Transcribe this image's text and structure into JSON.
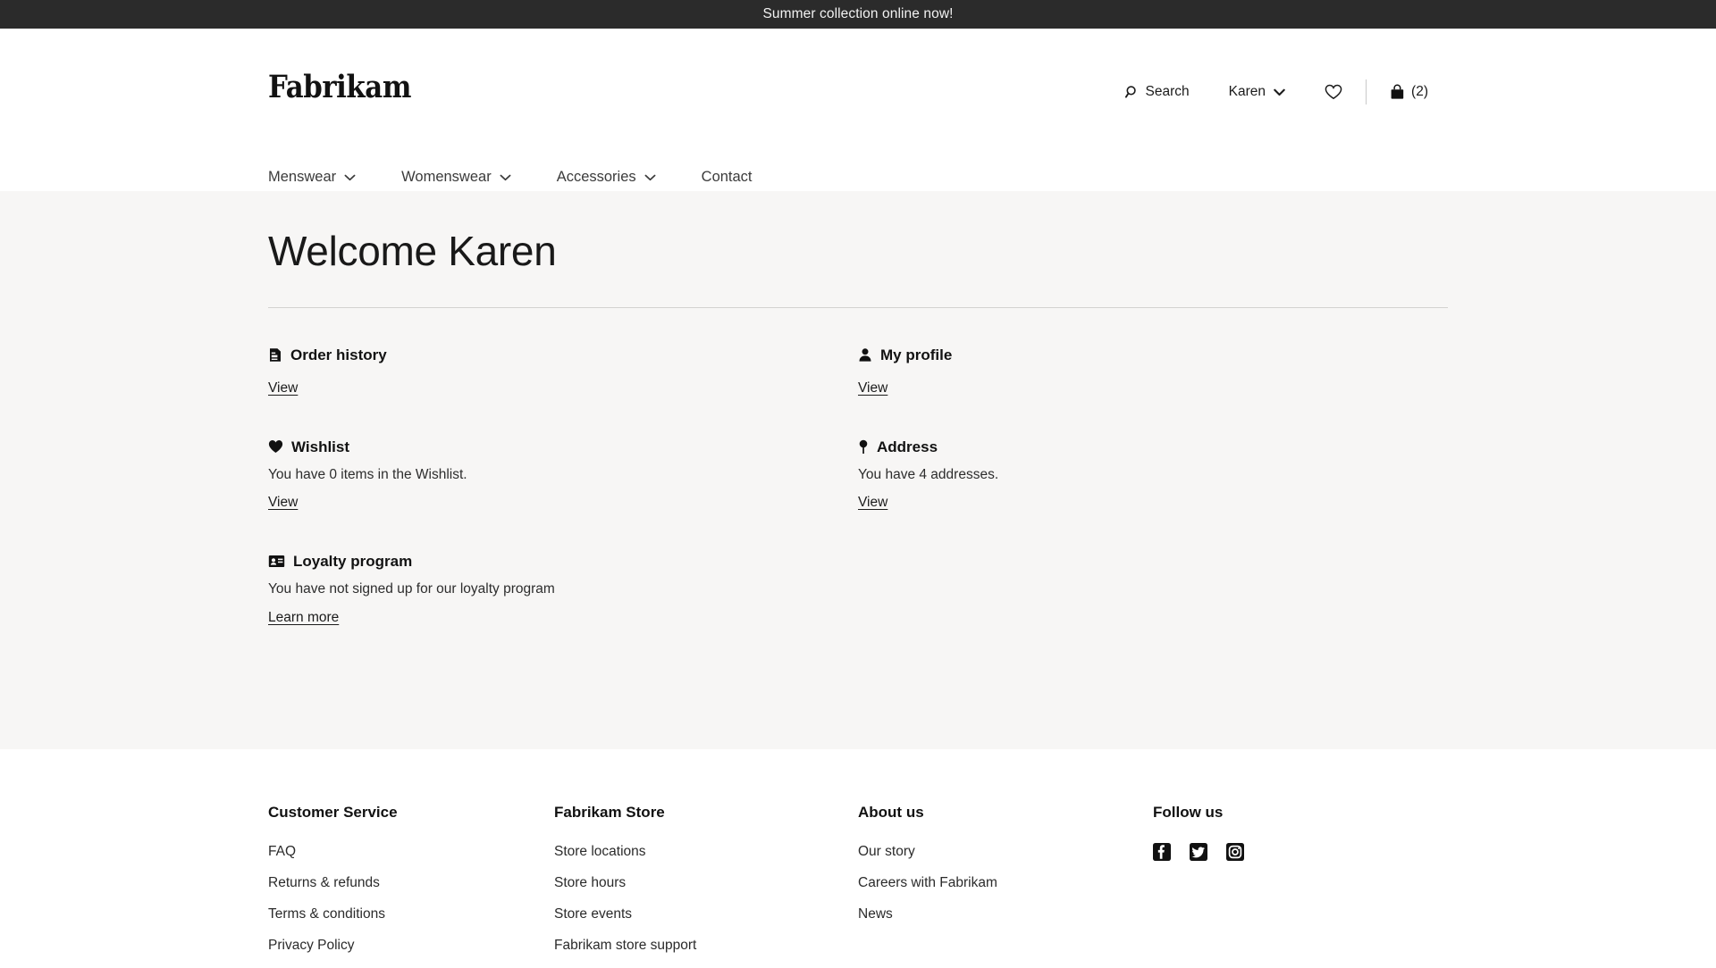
{
  "announcement": {
    "text": "Summer collection online now!"
  },
  "header": {
    "logo": "Fabrikam",
    "search_label": "Search",
    "account_label": "Karen",
    "cart_count_label": "(2)"
  },
  "nav": {
    "items": [
      {
        "label": "Menswear",
        "has_caret": true
      },
      {
        "label": "Womenswear",
        "has_caret": true
      },
      {
        "label": "Accessories",
        "has_caret": true
      },
      {
        "label": "Contact",
        "has_caret": false
      }
    ]
  },
  "main": {
    "page_title": "Welcome Karen",
    "cards": [
      {
        "id": "order-history",
        "icon": "receipt-icon",
        "title": "Order history",
        "description": "",
        "link": "View"
      },
      {
        "id": "my-profile",
        "icon": "person-icon",
        "title": "My profile",
        "description": "",
        "link": "View"
      },
      {
        "id": "wishlist",
        "icon": "heart-filled-icon",
        "title": "Wishlist",
        "description": "You have 0 items in the Wishlist.",
        "link": "View"
      },
      {
        "id": "address",
        "icon": "map-pin-icon",
        "title": "Address",
        "description": "You have 4 addresses.",
        "link": "View"
      },
      {
        "id": "loyalty-program",
        "icon": "id-card-icon",
        "title": "Loyalty program",
        "description": "You have not signed up for our loyalty program",
        "link": "Learn more"
      }
    ]
  },
  "footer": {
    "columns": [
      {
        "title": "Customer Service",
        "links": [
          "FAQ",
          "Returns & refunds",
          "Terms & conditions",
          "Privacy Policy"
        ]
      },
      {
        "title": "Fabrikam Store",
        "links": [
          "Store locations",
          "Store hours",
          "Store events",
          "Fabrikam store support"
        ]
      },
      {
        "title": "About us",
        "links": [
          "Our story",
          "Careers with Fabrikam",
          "News"
        ]
      }
    ],
    "social": {
      "title": "Follow us",
      "items": [
        "facebook-icon",
        "twitter-icon",
        "instagram-icon"
      ]
    }
  },
  "colors": {
    "announcement_bg": "#2b2b2b",
    "content_bg": "#f7f6f5",
    "text": "#1b1b1b",
    "rule": "#d3d2d0"
  }
}
